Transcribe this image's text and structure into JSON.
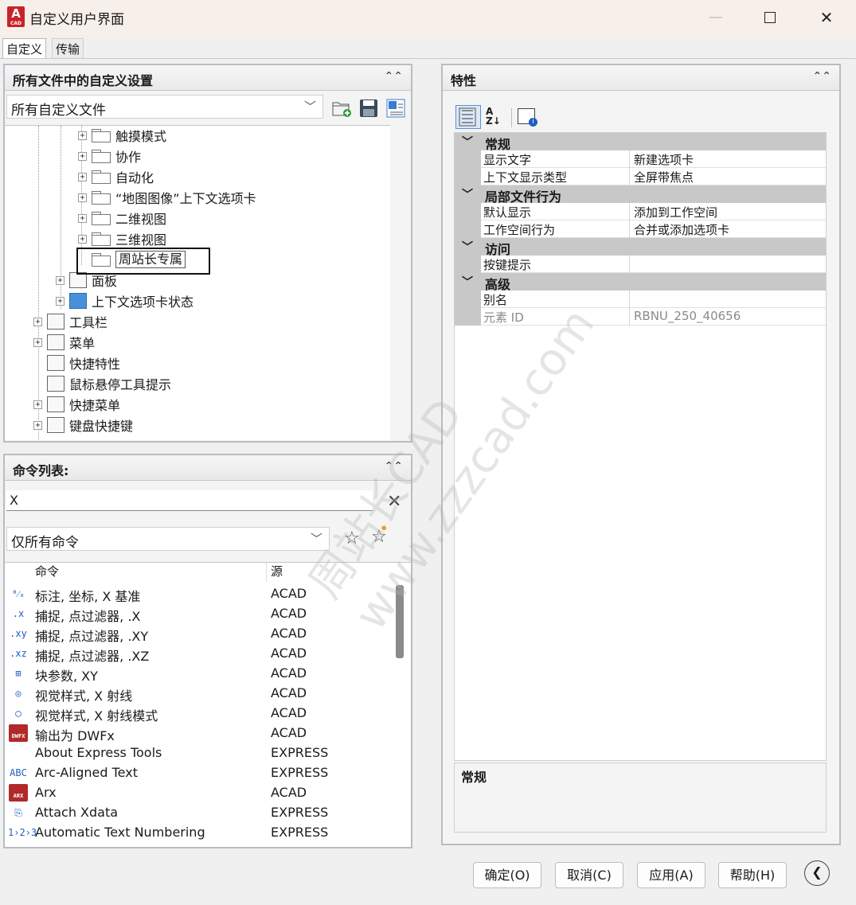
{
  "window": {
    "title": "自定义用户界面",
    "minimize": "—",
    "close": "✕"
  },
  "tabs": [
    {
      "label": "自定义"
    },
    {
      "label": "传输"
    }
  ],
  "customizations_panel": {
    "title": "所有文件中的自定义设置",
    "file_filter": "所有自定义文件",
    "tree": [
      {
        "label": "触摸模式"
      },
      {
        "label": "协作"
      },
      {
        "label": "自动化"
      },
      {
        "label": "“地图图像”上下文选项卡"
      },
      {
        "label": "二维视图"
      },
      {
        "label": "三维视图"
      },
      {
        "label": "周站长专属"
      },
      {
        "label": "面板"
      },
      {
        "label": "上下文选项卡状态"
      },
      {
        "label": "工具栏"
      },
      {
        "label": "菜单"
      },
      {
        "label": "快捷特性"
      },
      {
        "label": "鼠标悬停工具提示"
      },
      {
        "label": "快捷菜单"
      },
      {
        "label": "键盘快捷键"
      }
    ]
  },
  "command_panel": {
    "title": "命令列表:",
    "search_value": "X",
    "filter": "仅所有命令",
    "columns": {
      "command": "命令",
      "source": "源"
    },
    "rows": [
      {
        "icon": "ordinate-dim-icon",
        "glyph": "⁰⁄ₓ",
        "name": "标注, 坐标, X 基准",
        "source": "ACAD"
      },
      {
        "icon": "point-filter-x-icon",
        "glyph": ".x",
        "name": "捕捉, 点过滤器, .X",
        "source": "ACAD"
      },
      {
        "icon": "point-filter-xy-icon",
        "glyph": ".xy",
        "name": "捕捉, 点过滤器, .XY",
        "source": "ACAD"
      },
      {
        "icon": "point-filter-xz-icon",
        "glyph": ".xz",
        "name": "捕捉, 点过滤器, .XZ",
        "source": "ACAD"
      },
      {
        "icon": "block-param-xy-icon",
        "glyph": "⊞",
        "name": "块参数, XY",
        "source": "ACAD"
      },
      {
        "icon": "xray-visualstyle-icon",
        "glyph": "◎",
        "name": "视觉样式, X 射线",
        "source": "ACAD"
      },
      {
        "icon": "xray-mode-icon",
        "glyph": "◯",
        "name": "视觉样式, X 射线模式",
        "source": "ACAD"
      },
      {
        "icon": "dwfx-icon",
        "glyph": "DWFX",
        "name": "输出为 DWFx",
        "source": "ACAD"
      },
      {
        "icon": "",
        "glyph": "",
        "name": "About Express Tools",
        "source": "EXPRESS"
      },
      {
        "icon": "arc-text-icon",
        "glyph": "ABC",
        "name": "Arc-Aligned Text",
        "source": "EXPRESS"
      },
      {
        "icon": "arx-icon",
        "glyph": "ARX",
        "name": "Arx",
        "source": "ACAD"
      },
      {
        "icon": "attach-xdata-icon",
        "glyph": "⎘",
        "name": "Attach Xdata",
        "source": "EXPRESS"
      },
      {
        "icon": "text-numbering-icon",
        "glyph": "1›2›3",
        "name": "Automatic Text Numbering",
        "source": "EXPRESS"
      }
    ]
  },
  "properties_panel": {
    "title": "特性",
    "categories": [
      {
        "name": "常规",
        "toggle": "﹀",
        "props": [
          {
            "key": "显示文字",
            "value": "新建选项卡"
          },
          {
            "key": "上下文显示类型",
            "value": "全屏带焦点"
          }
        ]
      },
      {
        "name": "局部文件行为",
        "toggle": "﹀",
        "props": [
          {
            "key": "默认显示",
            "value": "添加到工作空间"
          },
          {
            "key": "工作空间行为",
            "value": "合并或添加选项卡"
          }
        ]
      },
      {
        "name": "访问",
        "toggle": "﹀",
        "props": [
          {
            "key": "按键提示",
            "value": ""
          }
        ]
      },
      {
        "name": "高级",
        "toggle": "﹀",
        "props": [
          {
            "key": "别名",
            "value": ""
          },
          {
            "key": "元素 ID",
            "value": "RBNU_250_40656"
          }
        ]
      }
    ],
    "description_title": "常规"
  },
  "buttons": {
    "ok": "确定(O)",
    "cancel": "取消(C)",
    "apply": "应用(A)",
    "help": "帮助(H)"
  },
  "watermark": {
    "line1": "周站长CAD",
    "line2": "www.zzzcad.com"
  },
  "colors": {
    "title_bar": "#f7efe9",
    "category_bg": "#c8c8c8",
    "autocad_red": "#c8232a"
  }
}
